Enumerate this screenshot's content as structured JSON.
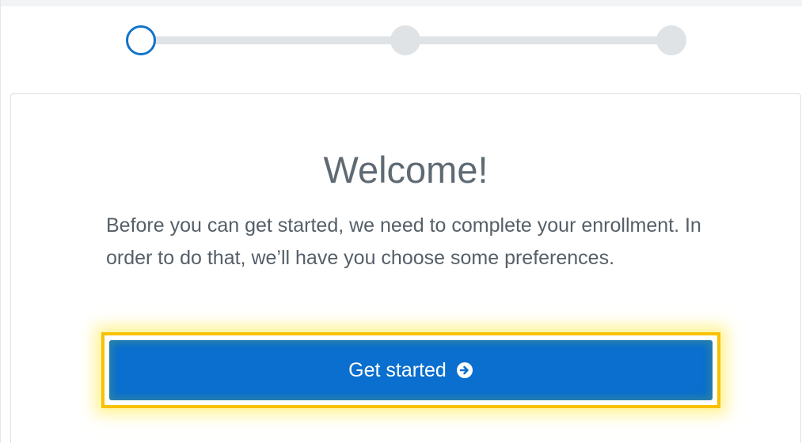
{
  "stepper": {
    "total_steps": 3,
    "current_step": 1,
    "colors": {
      "current": "#1273c9",
      "pending": "#dfe3e6"
    }
  },
  "welcome": {
    "title": "Welcome!",
    "message": "Before you can get started, we need to complete your enrollment. In order to do that, we’ll have you choose some preferences."
  },
  "actions": {
    "get_started_label": "Get started",
    "get_started_icon": "arrow-circle-right-icon",
    "button_color": "#0a6fce",
    "highlight_color": "#f7c100"
  }
}
